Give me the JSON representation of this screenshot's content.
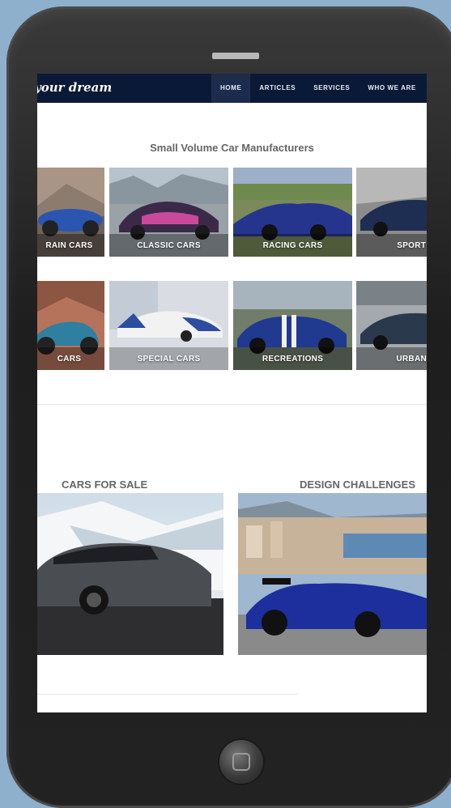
{
  "brand": {
    "text": "your dream"
  },
  "nav": [
    {
      "label": "HOME",
      "active": true
    },
    {
      "label": "ARTICLES",
      "active": false
    },
    {
      "label": "SERVICES",
      "active": false
    },
    {
      "label": "WHO WE ARE",
      "active": false
    }
  ],
  "manufacturers": {
    "title": "Small Volume Car Manufacturers",
    "row1": [
      "RAIN CARS",
      "CLASSIC CARS",
      "RACING CARS",
      "SPORT C"
    ],
    "row2": [
      "CARS",
      "SPECIAL CARS",
      "RECREATIONS",
      "URBAN C"
    ]
  },
  "sections": {
    "left_title": "CARS FOR SALE",
    "right_title": "DESIGN CHALLENGES"
  },
  "colors": {
    "navbar": "#0a1a36",
    "accent_blue": "#1f3aa8",
    "background": "#8fb0cc"
  }
}
